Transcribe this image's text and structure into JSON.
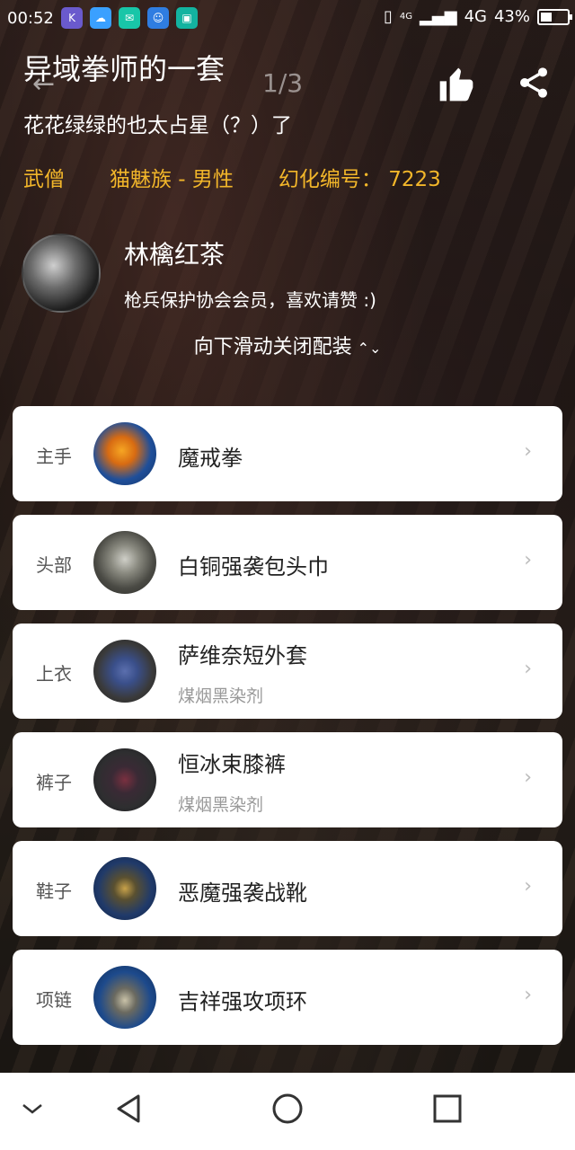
{
  "status_bar": {
    "time": "00:52",
    "network": "4G",
    "signal_small": "4G",
    "battery": "43%",
    "battery_level": 0.43
  },
  "header": {
    "title": "异域拳师的一套",
    "pager": "1/3",
    "subtitle": "花花绿绿的也太占星（？）了"
  },
  "meta": {
    "job": "武僧",
    "race_gender": "猫魅族 - 男性",
    "glamour_id": "幻化编号： 7223"
  },
  "author": {
    "name": "林檎红茶",
    "bio": "枪兵保护协会会员，喜欢请赞 :)"
  },
  "close_hint": "向下滑动关闭配装",
  "items": [
    {
      "slot": "主手",
      "name": "魔戒拳",
      "dye": "",
      "thumb_color": "#1f4f9a"
    },
    {
      "slot": "头部",
      "name": "白铜强袭包头巾",
      "dye": "",
      "thumb_color": "#4a4a44"
    },
    {
      "slot": "上衣",
      "name": "萨维奈短外套",
      "dye": "煤烟黑染剂",
      "thumb_color": "#3a3a3a"
    },
    {
      "slot": "裤子",
      "name": "恒冰束膝裤",
      "dye": "煤烟黑染剂",
      "thumb_color": "#2e2e30"
    },
    {
      "slot": "鞋子",
      "name": "恶魔强袭战靴",
      "dye": "",
      "thumb_color": "#203a6a"
    },
    {
      "slot": "项链",
      "name": "吉祥强攻项环",
      "dye": "",
      "thumb_color": "#1d4a8c"
    }
  ],
  "colors": {
    "accent": "#f2b62a",
    "card_bg": "#ffffff"
  }
}
